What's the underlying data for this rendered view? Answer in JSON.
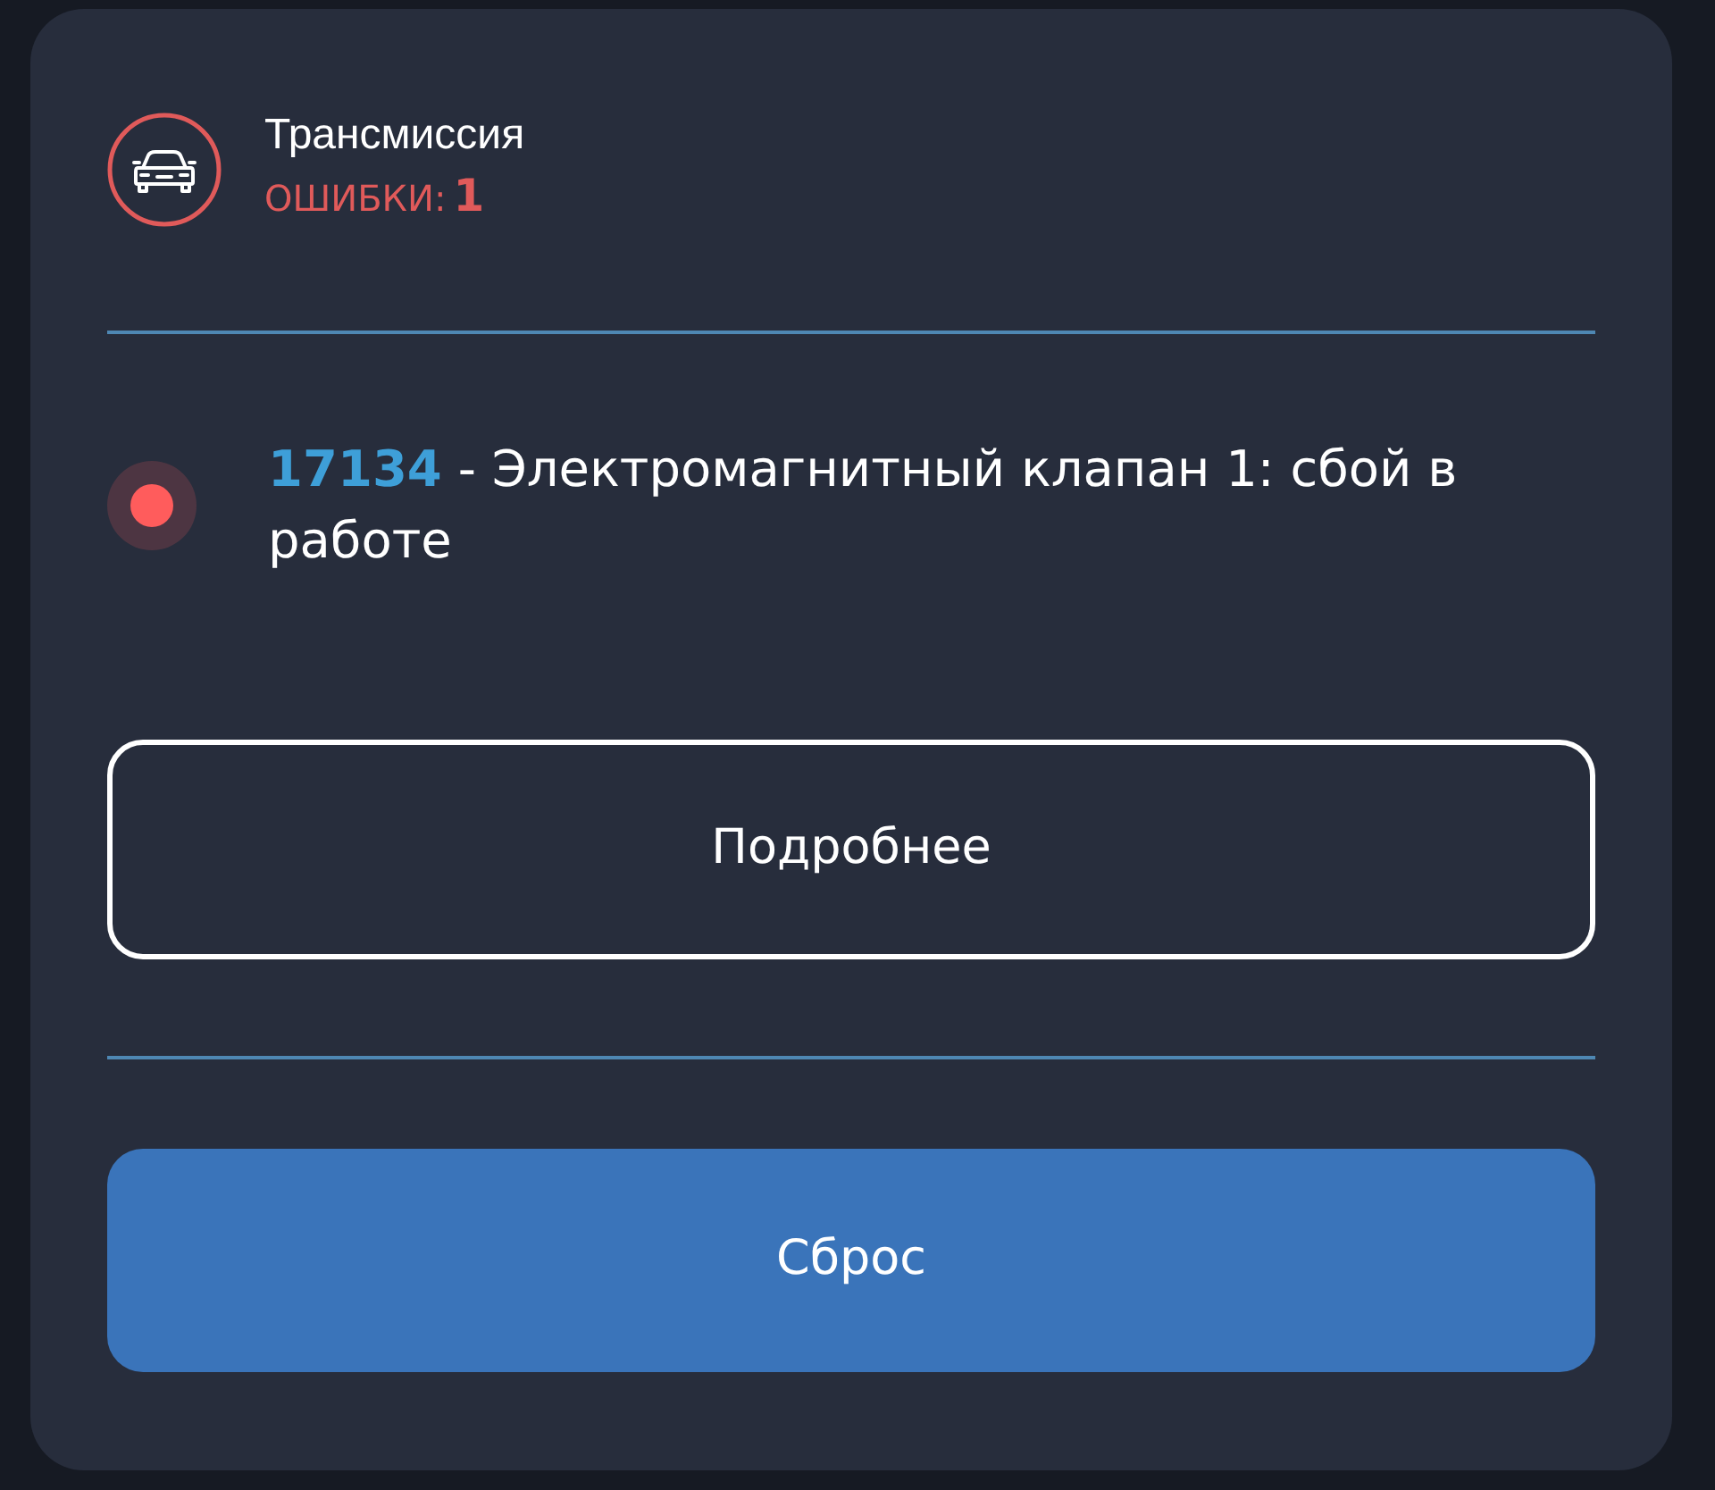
{
  "header": {
    "title": "Трансмиссия",
    "errors_label": "ОШИБКИ:",
    "errors_count": "1"
  },
  "errors": [
    {
      "code": "17134",
      "text": " - Электромагнитный клапан 1: сбой в работе",
      "color": "#ff5c5c"
    }
  ],
  "details_button": {
    "label": "Подробнее"
  },
  "reset_button": {
    "label": "Сброс"
  }
}
